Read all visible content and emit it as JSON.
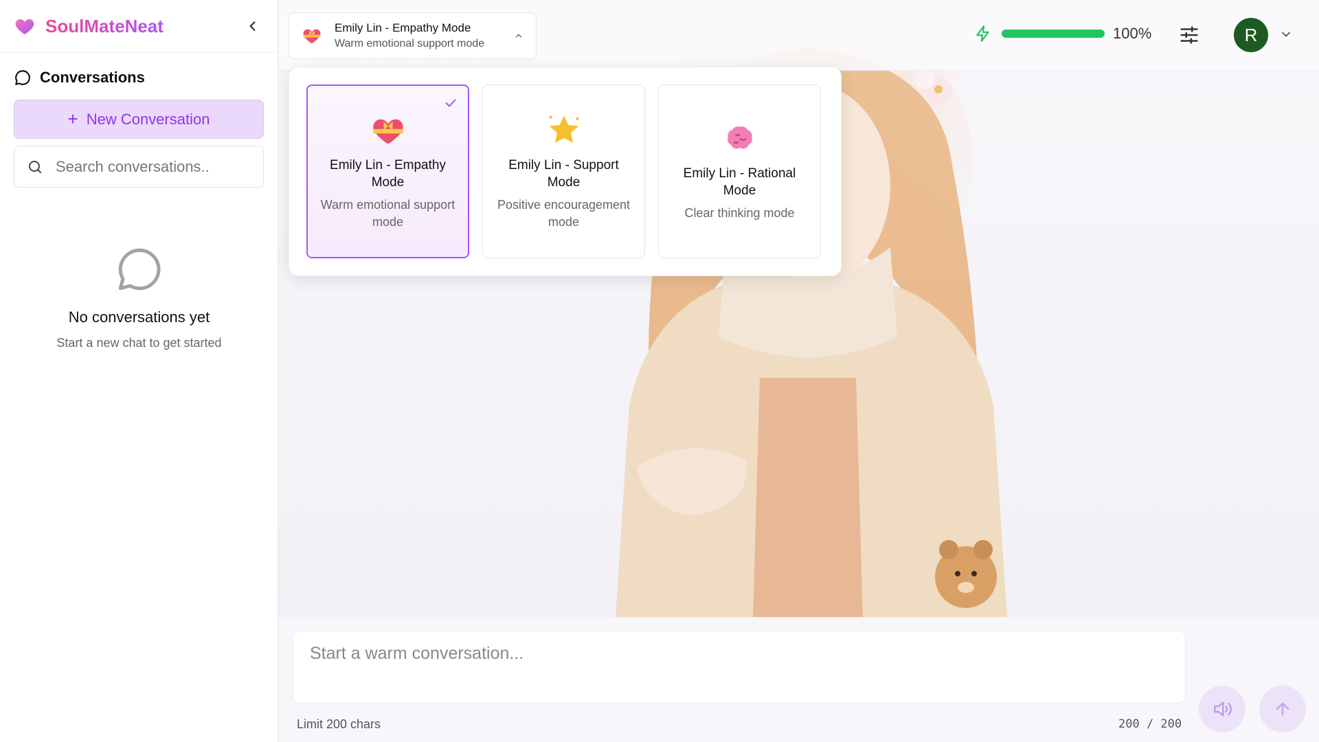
{
  "sidebar": {
    "brand": "SoulMateNeat",
    "conversations_label": "Conversations",
    "new_conversation": "New Conversation",
    "search_placeholder": "Search conversations..",
    "empty_title": "No conversations yet",
    "empty_subtitle": "Start a new chat to get started"
  },
  "header": {
    "current_mode": {
      "title": "Emily Lin - Empathy Mode",
      "subtitle": "Warm emotional support mode"
    },
    "energy_percent": "100%",
    "energy_level": 1.0,
    "avatar_initial": "R"
  },
  "modes": [
    {
      "name": "Emily Lin - Empathy Mode",
      "description": "Warm emotional support mode",
      "icon": "heart-with-ribbon-icon",
      "selected": true
    },
    {
      "name": "Emily Lin - Support Mode",
      "description": "Positive encouragement mode",
      "icon": "glowing-star-icon",
      "selected": false
    },
    {
      "name": "Emily Lin - Rational Mode",
      "description": "Clear thinking mode",
      "icon": "brain-icon",
      "selected": false
    }
  ],
  "composer": {
    "placeholder": "Start a warm conversation...",
    "limit_text": "Limit 200 chars",
    "char_count": "200 / 200"
  },
  "colors": {
    "brand_pink": "#ec4899",
    "brand_purple": "#a855f7",
    "energy_green": "#22c55e",
    "avatar_bg": "#1e5b23"
  }
}
